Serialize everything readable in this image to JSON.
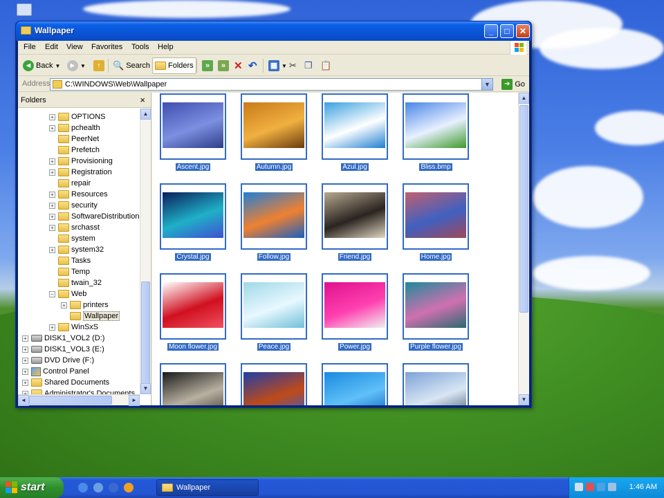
{
  "window": {
    "title": "Wallpaper",
    "controls": [
      "minimize",
      "maximize",
      "close"
    ]
  },
  "menu": [
    "File",
    "Edit",
    "View",
    "Favorites",
    "Tools",
    "Help"
  ],
  "toolbar": {
    "back": "Back",
    "search": "Search",
    "folders": "Folders"
  },
  "address": {
    "label": "Address",
    "path": "C:\\WINDOWS\\Web\\Wallpaper",
    "go": "Go"
  },
  "folders_pane": {
    "title": "Folders",
    "close": "×",
    "items": [
      {
        "label": "OPTIONS",
        "expander": "+"
      },
      {
        "label": "pchealth",
        "expander": "+"
      },
      {
        "label": "PeerNet",
        "expander": ""
      },
      {
        "label": "Prefetch",
        "expander": ""
      },
      {
        "label": "Provisioning",
        "expander": "+"
      },
      {
        "label": "Registration",
        "expander": "+"
      },
      {
        "label": "repair",
        "expander": ""
      },
      {
        "label": "Resources",
        "expander": "+"
      },
      {
        "label": "security",
        "expander": "+"
      },
      {
        "label": "SoftwareDistribution",
        "expander": "+"
      },
      {
        "label": "srchasst",
        "expander": "+"
      },
      {
        "label": "system",
        "expander": ""
      },
      {
        "label": "system32",
        "expander": "+"
      },
      {
        "label": "Tasks",
        "expander": ""
      },
      {
        "label": "Temp",
        "expander": ""
      },
      {
        "label": "twain_32",
        "expander": ""
      },
      {
        "label": "Web",
        "expander": "−"
      },
      {
        "label": "printers",
        "expander": "+"
      },
      {
        "label": "Wallpaper",
        "expander": ""
      },
      {
        "label": "WinSxS",
        "expander": "+"
      },
      {
        "label": "DISK1_VOL2 (D:)",
        "expander": "+"
      },
      {
        "label": "DISK1_VOL3 (E:)",
        "expander": "+"
      },
      {
        "label": "DVD Drive (F:)",
        "expander": "+"
      },
      {
        "label": "Control Panel",
        "expander": "+"
      },
      {
        "label": "Shared Documents",
        "expander": "+"
      },
      {
        "label": "Administrator's Documents",
        "expander": "+"
      }
    ]
  },
  "thumbnails": [
    {
      "label": "Ascent.jpg",
      "colors": [
        "#3f4fb0",
        "#7c8fe0",
        "#2e3d8a"
      ]
    },
    {
      "label": "Autumn.jpg",
      "colors": [
        "#c97a1a",
        "#f0b040",
        "#6b3a10"
      ]
    },
    {
      "label": "Azul.jpg",
      "colors": [
        "#3aa0e0",
        "#ffffff",
        "#1f7fd0"
      ]
    },
    {
      "label": "Bliss.bmp",
      "colors": [
        "#4a86e8",
        "#e8f0ff",
        "#3f9a2a"
      ]
    },
    {
      "label": "Crystal.jpg",
      "colors": [
        "#0a1f5a",
        "#1fb0c8",
        "#4050d0"
      ]
    },
    {
      "label": "Follow.jpg",
      "colors": [
        "#1f7fd8",
        "#f08030",
        "#1a60c0"
      ]
    },
    {
      "label": "Friend.jpg",
      "colors": [
        "#b8a890",
        "#2a2420",
        "#e0d6c0"
      ]
    },
    {
      "label": "Home.jpg",
      "colors": [
        "#c06070",
        "#4060c0",
        "#a04858"
      ]
    },
    {
      "label": "Moon flower.jpg",
      "colors": [
        "#ffffff",
        "#d01020",
        "#f05060"
      ]
    },
    {
      "label": "Peace.jpg",
      "colors": [
        "#a0d8e8",
        "#e8f8ff",
        "#70c0d8"
      ]
    },
    {
      "label": "Power.jpg",
      "colors": [
        "#e0108c",
        "#ff40b0",
        "#f0f0f0"
      ]
    },
    {
      "label": "Purple flower.jpg",
      "colors": [
        "#1f8a9a",
        "#d070b0",
        "#2a6a70"
      ]
    },
    {
      "label": "",
      "colors": [
        "#1a1a1a",
        "#b8b0a0",
        "#3a3530"
      ]
    },
    {
      "label": "",
      "colors": [
        "#1f3fa8",
        "#c04a18",
        "#3060d0"
      ]
    },
    {
      "label": "",
      "colors": [
        "#1a8ae0",
        "#60c0f8",
        "#0a60c0"
      ]
    },
    {
      "label": "",
      "colors": [
        "#7ea2d8",
        "#d8e6f4",
        "#4a5a70"
      ]
    }
  ],
  "taskbar": {
    "start": "start",
    "task": "Wallpaper",
    "clock": "1:46 AM"
  }
}
